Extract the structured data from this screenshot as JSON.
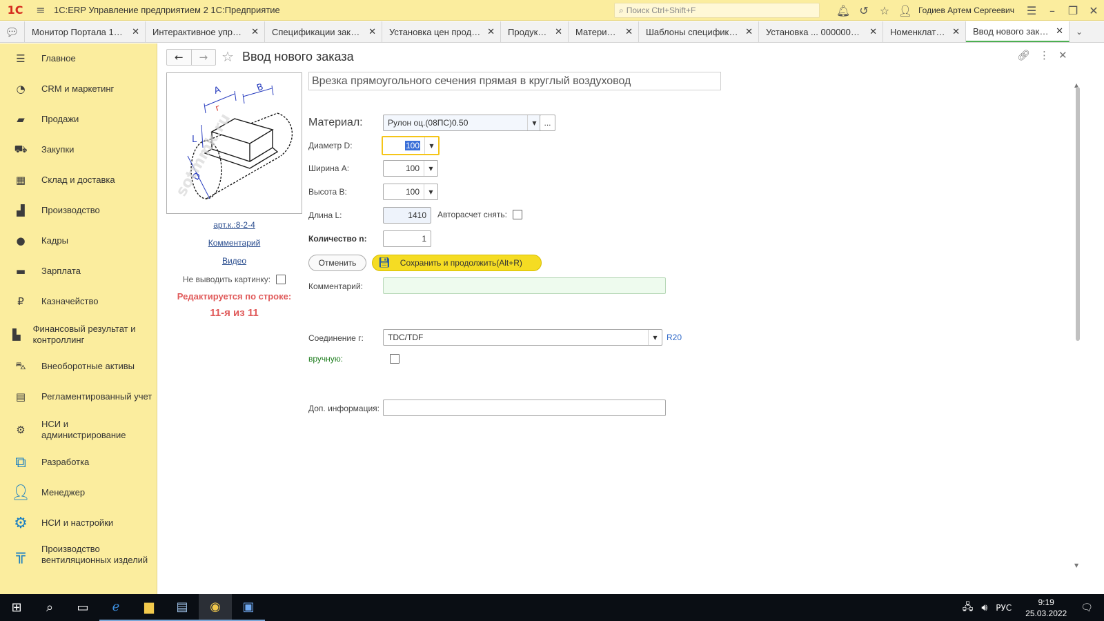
{
  "titlebar": {
    "logo": "1С",
    "app_title": "1С:ERP Управление предприятием 2 1С:Предприятие",
    "search_placeholder": "Поиск Ctrl+Shift+F",
    "user_name": "Годиев Артем Сергеевич"
  },
  "tabs": [
    {
      "label": "Монитор Портала 1С:..."
    },
    {
      "label": "Интерактивное управ..."
    },
    {
      "label": "Спецификации заказов"
    },
    {
      "label": "Установка цен продук..."
    },
    {
      "label": "Продукция"
    },
    {
      "label": "Материалы"
    },
    {
      "label": "Шаблоны спецификации"
    },
    {
      "label": "Установка ... 000000025"
    },
    {
      "label": "Номенклатура"
    },
    {
      "label": "Ввод нового заказа"
    }
  ],
  "sidebar": {
    "items": [
      {
        "label": "Главное",
        "icon": "menu-icon"
      },
      {
        "label": "CRM и маркетинг",
        "icon": "pie-chart-icon"
      },
      {
        "label": "Продажи",
        "icon": "bag-icon"
      },
      {
        "label": "Закупки",
        "icon": "cart-icon"
      },
      {
        "label": "Склад и доставка",
        "icon": "warehouse-icon"
      },
      {
        "label": "Производство",
        "icon": "factory-icon"
      },
      {
        "label": "Кадры",
        "icon": "person-icon"
      },
      {
        "label": "Зарплата",
        "icon": "wallet-icon"
      },
      {
        "label": "Казначейство",
        "icon": "ruble-icon"
      },
      {
        "label": "Финансовый результат и контроллинг",
        "icon": "bar-chart-icon"
      },
      {
        "label": "Внеоборотные активы",
        "icon": "truck-icon"
      },
      {
        "label": "Регламентированный учет",
        "icon": "document-icon"
      },
      {
        "label": "НСИ и администрирование",
        "icon": "gear-icon"
      },
      {
        "label": "Разработка",
        "icon": "development-icon"
      },
      {
        "label": "Менеджер",
        "icon": "manager-icon"
      },
      {
        "label": "НСИ и настройки",
        "icon": "gears-icon"
      },
      {
        "label": "Производство вентиляционных изделий",
        "icon": "duct-icon"
      }
    ]
  },
  "form": {
    "title": "Ввод нового заказа",
    "product_name": "Врезка прямоугольного сечения прямая в круглый воздуховод",
    "article_link": "арт.к.:8-2-4",
    "comment_link": "Комментарий",
    "video_link": "Видео",
    "no_picture_label": "Не выводить картинку:",
    "editing_line1": "Редактируется по строке:",
    "editing_line2": "11-я из 11",
    "material_label": "Материал:",
    "material_value": "Рулон оц.(08ПС)0.50",
    "material_more": "...",
    "diameter_label": "Диаметр D:",
    "diameter_value": "100",
    "width_label": "Ширина А:",
    "width_value": "100",
    "height_label": "Высота В:",
    "height_value": "100",
    "length_label": "Длина L:",
    "length_value": "1410",
    "autocalc_label": "Авторасчет снять:",
    "quantity_label": "Количество n:",
    "quantity_value": "1",
    "cancel_label": "Отменить",
    "save_label": "Сохранить и продолжить(Alt+R)",
    "comment_label": "Комментарий:",
    "comment_value": "",
    "connection_label": "Соединение г:",
    "connection_value": "TDC/TDF",
    "connection_extra": "R20",
    "manual_label": "вручную:",
    "extra_info_label": "Доп. информация:",
    "extra_info_value": ""
  },
  "taskbar": {
    "lang": "РУС",
    "time": "9:19",
    "date": "25.03.2022"
  }
}
